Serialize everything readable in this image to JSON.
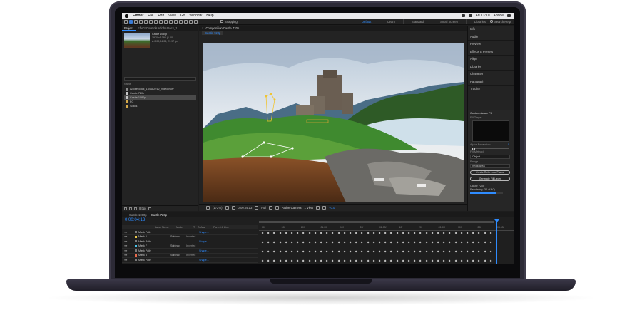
{
  "menubar": {
    "items": [
      "Finder",
      "File",
      "Edit",
      "View",
      "Go",
      "Window",
      "Help"
    ],
    "clock": "Fri 13:10",
    "app": "Adobe"
  },
  "toolbar": {
    "snapping_label": "Snapping",
    "workspaces": [
      "Default",
      "Learn",
      "Standard",
      "Small Screen",
      "Libraries"
    ],
    "active_workspace": "Default",
    "search_help": "Search Help"
  },
  "project": {
    "tabs": [
      "Project",
      "Effect Controls AdobeStock_1..."
    ],
    "selected_name": "Castle 1080p",
    "selected_info": [
      "1920 x 1080 (1.00)",
      "Δ 0;00;04;03, 29.97 fps"
    ],
    "column_name": "Name",
    "items": [
      {
        "name": "AdobeStock_154482912_Video.mov",
        "type": "footage",
        "selected": false
      },
      {
        "name": "Castle 720p",
        "type": "comp",
        "selected": false
      },
      {
        "name": "Castle 1080p",
        "type": "comp",
        "selected": true
      },
      {
        "name": "FG",
        "type": "folder",
        "selected": false
      },
      {
        "name": "Solids",
        "type": "folder",
        "selected": false
      }
    ],
    "bpc": "8 bpc"
  },
  "composition": {
    "tab_label": "Composition Castle 720p",
    "sub_tab": "Castle 720p",
    "zoom": "(172%)",
    "timecode": "0:00:04:13",
    "resolution": "Full",
    "camera": "Active Camera",
    "view": "1 View",
    "exposure": "+0.0"
  },
  "right_panel": {
    "items": [
      "Info",
      "Audio",
      "Preview",
      "Effects & Presets",
      "Align",
      "Libraries",
      "Character",
      "Paragraph",
      "Tracker"
    ],
    "content_aware_fill": {
      "title": "Content-Aware Fill",
      "fill_target_label": "Fill Target",
      "alpha_label": "Alpha Expansion",
      "alpha_value": "0",
      "fill_method_label": "Fill Method",
      "fill_method": "Object",
      "range_label": "Range",
      "range": "Work Area",
      "create_ref_button": "Create Reference Frame",
      "generate_button": "Generate Fill Layer",
      "render_comp": "Castle 720p",
      "render_status": "Rendering (32 of 40)...",
      "progress": 0.8
    }
  },
  "timeline": {
    "tabs": [
      "Castle 1080p",
      "Castle 720p"
    ],
    "active_tab": "Castle 720p",
    "timecode": "0:00:04:13",
    "columns": [
      "Layer Name",
      "Mode",
      "T",
      "TrkMat",
      "Parent & Link"
    ],
    "layers": [
      {
        "name": "Mask Path",
        "mode": "",
        "inv": "",
        "link": "Shape...",
        "color": "#7a7a7a"
      },
      {
        "name": "Mask 6",
        "mode": "Subtract",
        "inv": "Inverted",
        "link": "",
        "color": "#e8c64b"
      },
      {
        "name": "Mask Path",
        "mode": "",
        "inv": "",
        "link": "Shape...",
        "color": "#7a7a7a"
      },
      {
        "name": "Mask 7",
        "mode": "Subtract",
        "inv": "Inverted",
        "link": "",
        "color": "#4bc3e8"
      },
      {
        "name": "Mask Path",
        "mode": "",
        "inv": "",
        "link": "Shape...",
        "color": "#7a7a7a"
      },
      {
        "name": "Mask 8",
        "mode": "Subtract",
        "inv": "Inverted",
        "link": "",
        "color": "#e86a4b"
      },
      {
        "name": "Mask Path",
        "mode": "",
        "inv": "",
        "link": "Shape...",
        "color": "#7a7a7a"
      }
    ],
    "ruler_ticks": [
      "00f",
      "10f",
      "20f",
      "01:00f",
      "10f",
      "20f",
      "02:00f",
      "10f",
      "20f",
      "03:00f",
      "10f",
      "20f",
      "04:00f"
    ]
  },
  "colors": {
    "accent": "#2f8cff",
    "panel": "#232323",
    "laptop": "#2c2a36"
  }
}
